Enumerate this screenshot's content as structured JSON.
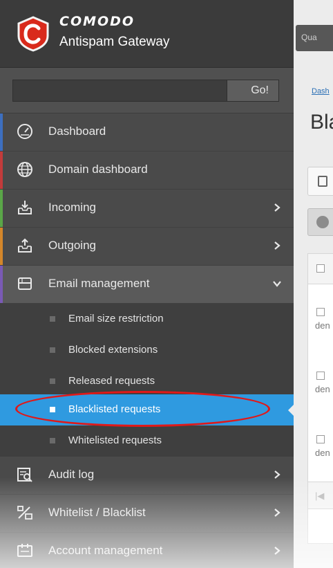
{
  "brand": {
    "name": "COMODO",
    "product": "Antispam Gateway"
  },
  "topbar": {
    "button_label": "Qua"
  },
  "search": {
    "go_label": "Go!"
  },
  "nav": {
    "dashboard": "Dashboard",
    "domain_dashboard": "Domain dashboard",
    "incoming": "Incoming",
    "outgoing": "Outgoing",
    "email_management": "Email management",
    "audit_log": "Audit log",
    "whitelist_blacklist": "Whitelist / Blacklist",
    "account_management": "Account management"
  },
  "submenu": {
    "email_size_restriction": "Email size restriction",
    "blocked_extensions": "Blocked extensions",
    "released_requests": "Released requests",
    "blacklisted_requests": "Blacklisted requests",
    "whitelisted_requests": "Whitelisted requests"
  },
  "main": {
    "breadcrumb": "Dash",
    "title": "Bla",
    "rows": [
      "den",
      "den",
      "den"
    ],
    "pager_label": "|◀"
  },
  "colors": {
    "sidebar_bg": "#4a4a4a",
    "selected_bg": "#2f9ae0",
    "highlight_ring": "#e01919",
    "stripe_dashboard": "#3d6fbf",
    "stripe_domain": "#c23b3b",
    "stripe_incoming": "#5aa648",
    "stripe_outgoing": "#d4862a",
    "stripe_email": "#7a5ab5"
  }
}
